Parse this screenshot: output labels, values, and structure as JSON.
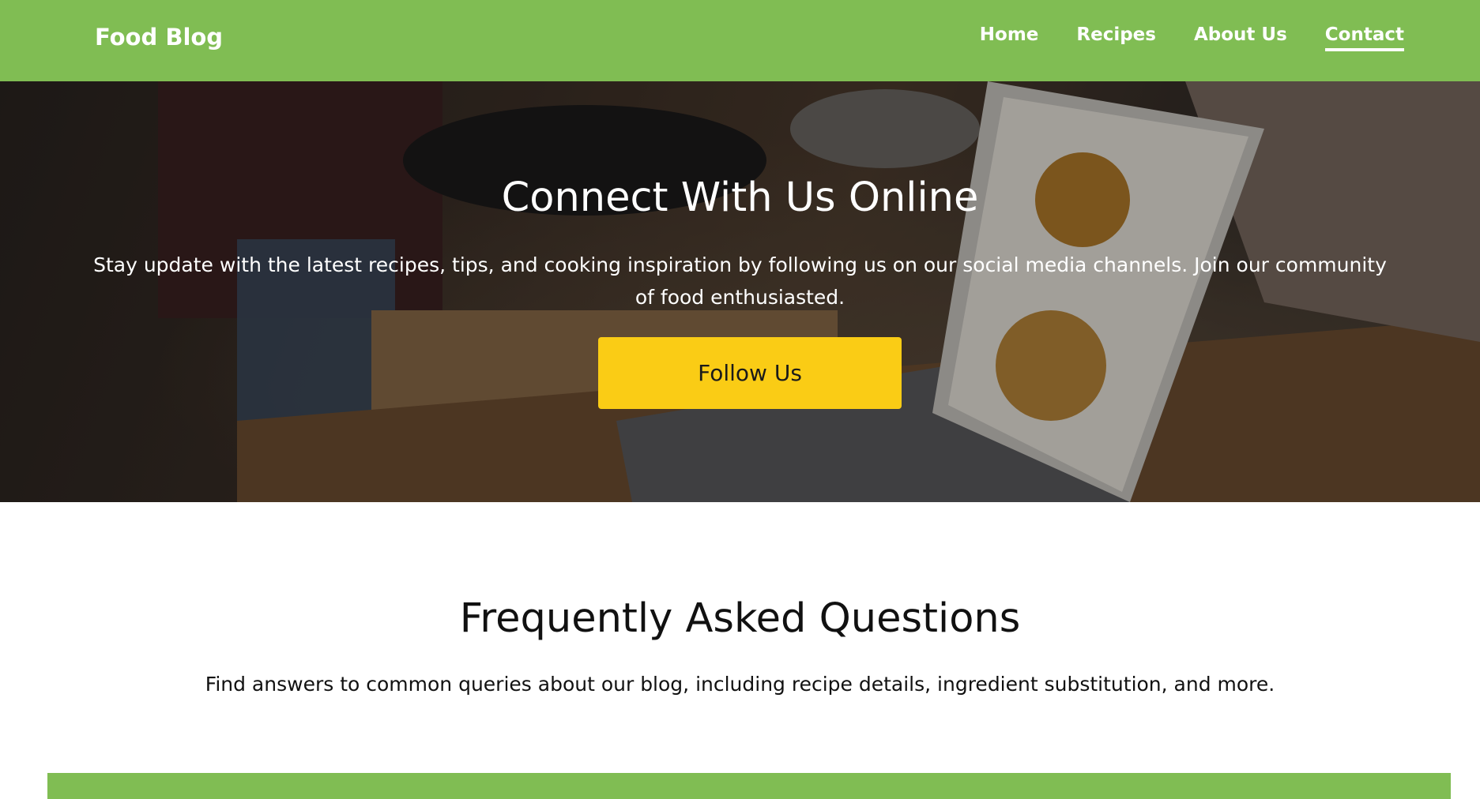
{
  "header": {
    "brand": "Food Blog",
    "nav": [
      {
        "label": "Home",
        "active": false
      },
      {
        "label": "Recipes",
        "active": false
      },
      {
        "label": "About Us",
        "active": false
      },
      {
        "label": "Contact",
        "active": true
      }
    ]
  },
  "hero": {
    "title": "Connect With Us Online",
    "text": "Stay update with the latest recipes, tips, and cooking inspiration by following us on our social media channels. Join our community of food enthusiasted.",
    "button_label": "Follow Us"
  },
  "faq": {
    "title": "Frequently Asked Questions",
    "subtitle": "Find answers to common queries about our blog, including recipe details, ingredient substitution, and more."
  },
  "colors": {
    "header_bg": "#80bd53",
    "button_bg": "#facc15",
    "text_dark": "#111111",
    "text_light": "#ffffff"
  }
}
